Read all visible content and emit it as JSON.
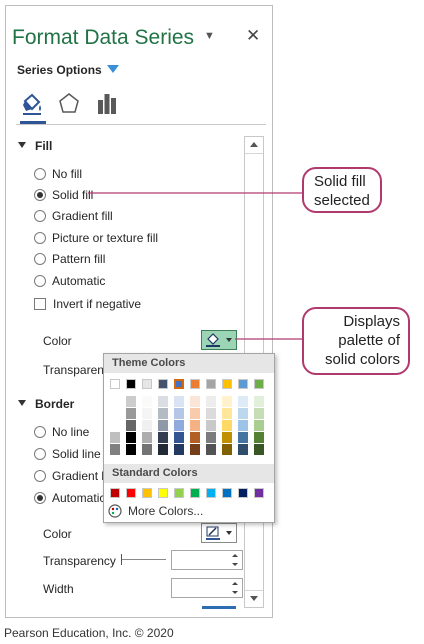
{
  "pane": {
    "title": "Format Data Series",
    "close_label": "✕",
    "series_options_label": "Series Options"
  },
  "tabs": [
    {
      "name": "fill-line-tab",
      "icon": "paint-bucket-icon"
    },
    {
      "name": "effects-tab",
      "icon": "pentagon-icon"
    },
    {
      "name": "series-options-tab",
      "icon": "bar-chart-icon"
    }
  ],
  "fill": {
    "heading": "Fill",
    "options": [
      "No fill",
      "Solid fill",
      "Gradient fill",
      "Picture or texture fill",
      "Pattern fill",
      "Automatic"
    ],
    "selected": "Solid fill",
    "invert_label": "Invert if negative",
    "color_label": "Color",
    "transparency_label": "Transparency"
  },
  "border": {
    "heading": "Border",
    "options": [
      "No line",
      "Solid line",
      "Gradient line",
      "Automatic"
    ],
    "selected": "Automatic",
    "color_label": "Color",
    "transparency_label": "Transparency",
    "width_label": "Width"
  },
  "palette": {
    "theme_label": "Theme Colors",
    "standard_label": "Standard Colors",
    "more_colors_label": "More Colors...",
    "theme_colors": [
      "#ffffff",
      "#000000",
      "#e7e6e6",
      "#44546a",
      "#4472c4",
      "#ed7d31",
      "#a5a5a5",
      "#ffc000",
      "#5b9bd5",
      "#70ad47"
    ],
    "selected_theme_color": "#4472c4",
    "standard_colors": [
      "#c00000",
      "#ff0000",
      "#ffc000",
      "#ffff00",
      "#92d050",
      "#00b050",
      "#00b0f0",
      "#0070c0",
      "#002060",
      "#7030a0"
    ]
  },
  "callouts": {
    "solid_fill": "Solid fill selected",
    "palette": "Displays palette of solid colors"
  },
  "copyright": "Pearson Education, Inc. © 2020",
  "colors": {
    "accent": "#217346",
    "callout_border": "#b03a6e",
    "selected_fill": "#9cd5b6"
  }
}
